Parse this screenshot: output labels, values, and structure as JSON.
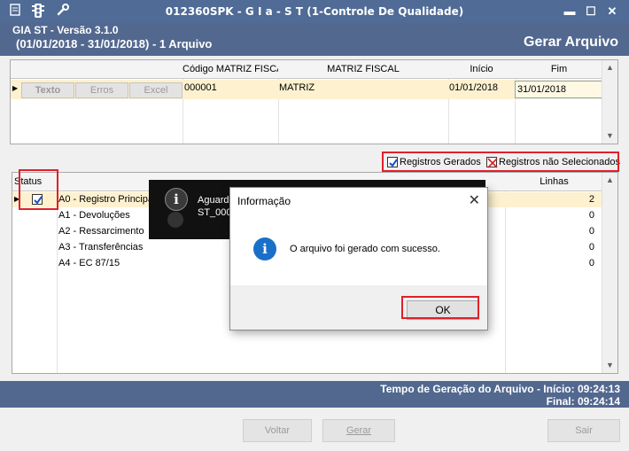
{
  "window": {
    "title": "012360SPK - G I a - S T (1-Controle De Qualidade)",
    "minimize": "▬",
    "maximize": "☐",
    "close": "✕"
  },
  "header": {
    "app_version": "GIA ST - Versão 3.1.0",
    "period": "(01/01/2018 - 31/01/2018) - 1 Arquivo",
    "screen_title": "Gerar Arquivo"
  },
  "files_grid": {
    "columns": [
      "Código MATRIZ FISCA",
      "MATRIZ FISCAL",
      "Início",
      "Fim"
    ],
    "row_buttons": [
      "Texto",
      "Erros",
      "Excel"
    ],
    "rows": [
      {
        "codigo": "000001",
        "matriz": "MATRIZ",
        "inicio": "01/01/2018",
        "fim": "31/01/2018"
      }
    ]
  },
  "legend": {
    "generated": "Registros Gerados",
    "not_selected": "Registros não Selecionados"
  },
  "records_grid": {
    "col_status": "Status",
    "col_lines": "Linhas",
    "rows": [
      {
        "name": "A0 - Registro Principal",
        "lines": "2"
      },
      {
        "name": "A1 - Devoluções",
        "lines": "0"
      },
      {
        "name": "A2 - Ressarcimento",
        "lines": "0"
      },
      {
        "name": "A3 - Transferências",
        "lines": "0"
      },
      {
        "name": "A4 - EC 87/15",
        "lines": "0"
      }
    ]
  },
  "toast": {
    "line1": "Aguard",
    "line2": "ST_000"
  },
  "dialog": {
    "title": "Informação",
    "message": "O arquivo  foi gerado com sucesso.",
    "ok": "OK"
  },
  "status": {
    "start_label": "Tempo de Geração do Arquivo - Início: 09:24:13",
    "end_label": "Final: 09:24:14"
  },
  "buttons": {
    "back": "Voltar",
    "generate": "Gerar",
    "exit": "Sair"
  },
  "colors": {
    "titlebar": "#4f6b96",
    "header": "#52688f",
    "selected_row": "#fdf1cf",
    "highlight_box": "#e0202a",
    "info_blue": "#1a6fc9"
  }
}
